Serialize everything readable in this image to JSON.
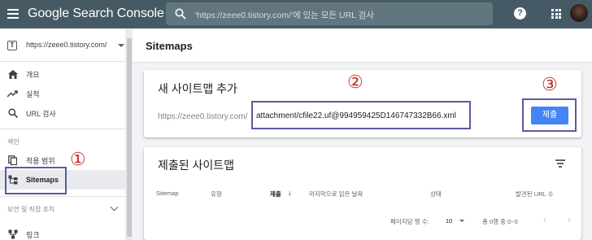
{
  "header": {
    "app_title": "Google Search Console",
    "search_placeholder": "'https://zeee0.tistory.com/'에 있는 모든 URL 검사"
  },
  "sidebar": {
    "property": "https://zeee0.tistory.com/",
    "items": [
      {
        "label": "개요",
        "icon": "home-icon"
      },
      {
        "label": "실적",
        "icon": "trending-up-icon"
      },
      {
        "label": "URL 검사",
        "icon": "search-icon"
      }
    ],
    "index_section_label": "색인",
    "index_items": [
      {
        "label": "적용 범위",
        "icon": "file-copy-icon"
      },
      {
        "label": "Sitemaps",
        "icon": "sitemap-icon",
        "active": true
      }
    ],
    "security_section_label": "보안 및 직접 조치",
    "links_label": "링크"
  },
  "main": {
    "page_title": "Sitemaps",
    "add_card": {
      "title": "새 사이트맵 추가",
      "url_prefix": "https://zeee0.tistory.com/",
      "input_value": "attachment/cfile22.uf@994959425D146747332B66.xml",
      "submit_label": "제출"
    },
    "submitted_card": {
      "title": "제출된 사이트맵",
      "columns": [
        "Sitemap",
        "유형",
        "제출",
        "마지막으로 읽은 날짜",
        "상태",
        "발견된 URL 수"
      ],
      "rows_per_page_label": "페이지당 행 수:",
      "rows_per_page_value": "10",
      "range_label": "총 0행 중 0~0"
    }
  },
  "annotations": [
    "①",
    "②",
    "③"
  ],
  "colors": {
    "topbar": "#455a64",
    "submit_button": "#4285f4",
    "annotation_box": "#5b5aa3",
    "annotation_number": "#c62828"
  }
}
